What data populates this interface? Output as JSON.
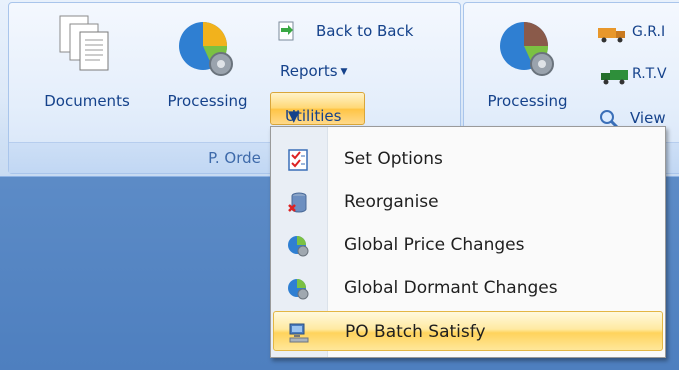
{
  "ribbon": {
    "group1": {
      "footer_label": "P. Orde",
      "documents_label": "Documents",
      "processing_label": "Processing",
      "back_to_back_label": "Back to Back",
      "reports_label": "Reports",
      "utilities_label": "Utilities"
    },
    "group2": {
      "processing_label": "Processing",
      "grn_label": "G.R.I",
      "rtv_label": "R.T.V",
      "view_label": "View"
    }
  },
  "menu": {
    "items": [
      {
        "label": "Set Options",
        "icon": "checklist-icon"
      },
      {
        "label": "Reorganise",
        "icon": "database-icon"
      },
      {
        "label": "Global Price Changes",
        "icon": "globe-gear-icon"
      },
      {
        "label": "Global Dormant Changes",
        "icon": "globe-gear-icon"
      },
      {
        "label": "PO Batch Satisfy",
        "icon": "computer-icon",
        "highlighted": true
      }
    ]
  }
}
